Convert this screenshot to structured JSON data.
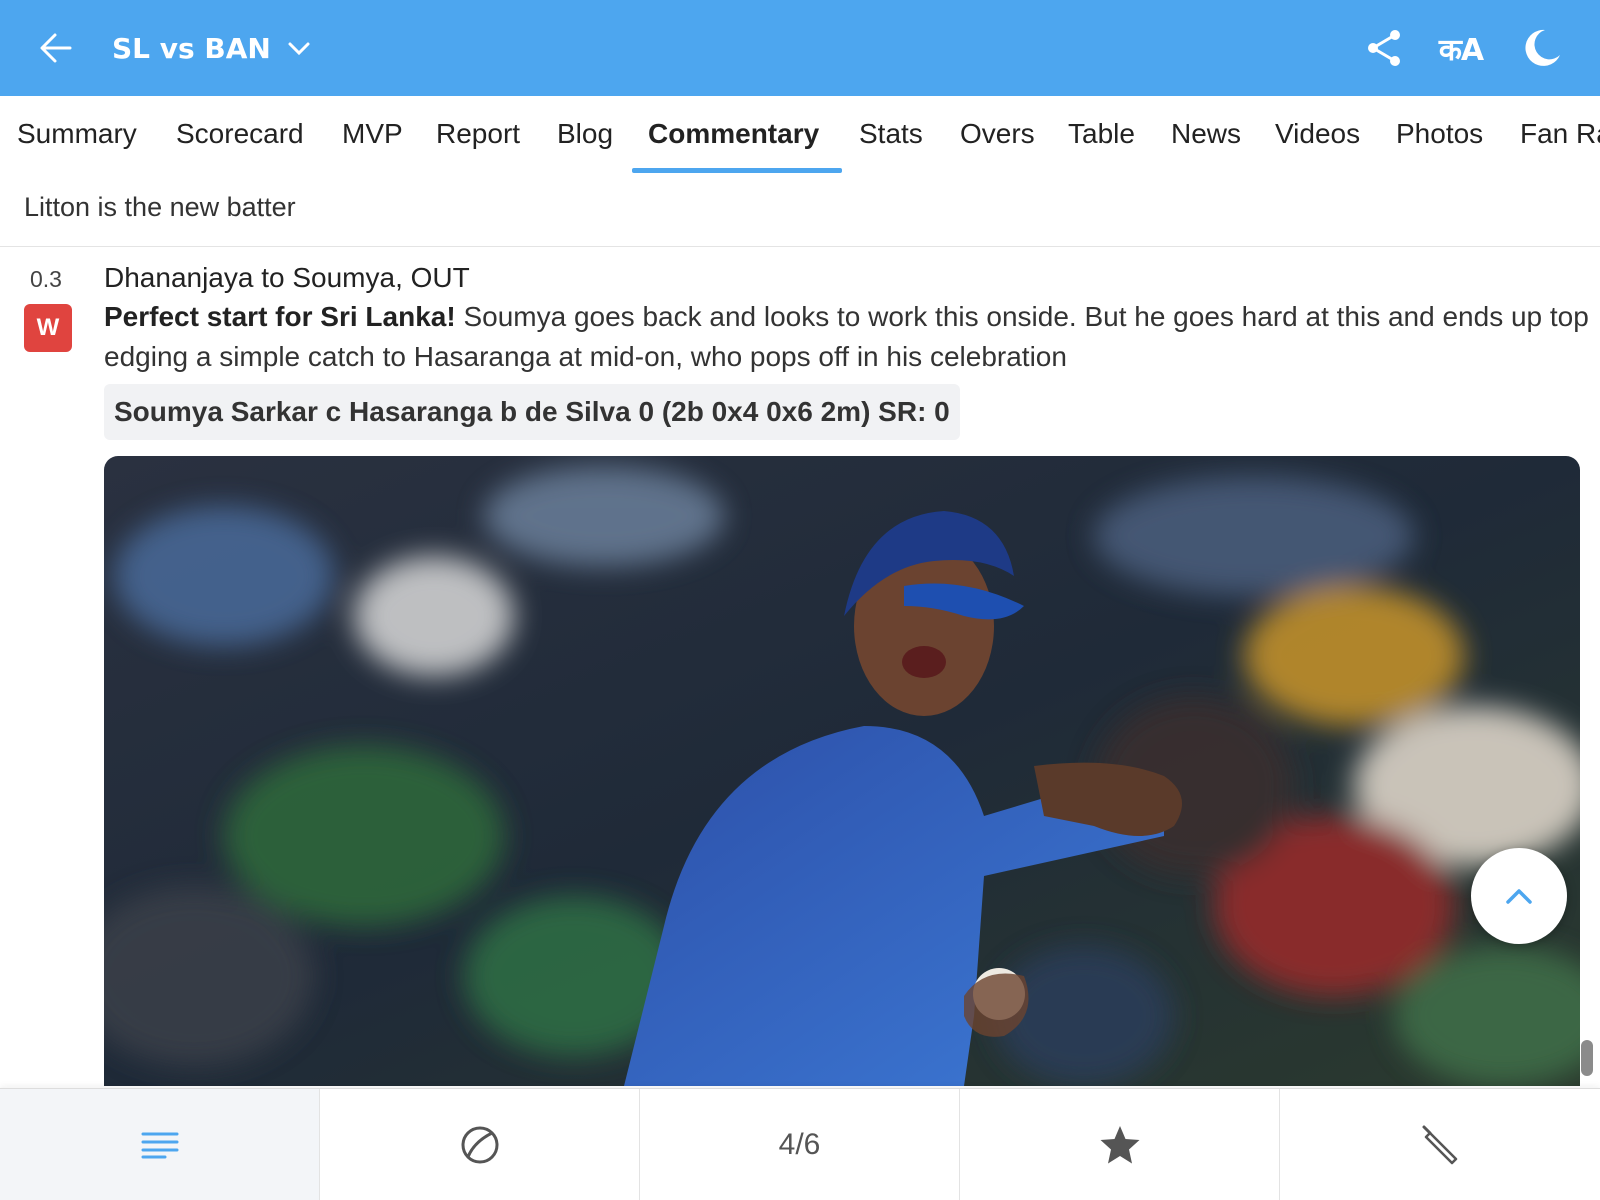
{
  "header": {
    "title": "SL vs BAN",
    "lang_label": "कA",
    "icons": [
      "back-arrow-icon",
      "chevron-down-icon",
      "share-icon",
      "language-icon",
      "moon-icon"
    ],
    "bg_color": "#4da6ef"
  },
  "tabs": [
    {
      "label": "Summary"
    },
    {
      "label": "Scorecard"
    },
    {
      "label": "MVP"
    },
    {
      "label": "Report"
    },
    {
      "label": "Blog"
    },
    {
      "label": "Commentary",
      "active": true
    },
    {
      "label": "Stats"
    },
    {
      "label": "Overs"
    },
    {
      "label": "Table"
    },
    {
      "label": "News"
    },
    {
      "label": "Videos"
    },
    {
      "label": "Photos"
    },
    {
      "label": "Fan Ra"
    }
  ],
  "commentary": {
    "previous_line": "Litton is the new batter",
    "ball": {
      "over": "0.3",
      "badge": "W",
      "badge_color": "#e0443f",
      "headline": "Dhananjaya to Soumya, OUT",
      "bold_lead": "Perfect start for Sri Lanka!",
      "text": " Soumya goes back and looks to work this onside. But he goes hard at this and ends up top edging a simple catch to Hasaranga at mid-on, who pops off in his celebration",
      "dismissal": "Soumya Sarkar c Hasaranga b de Silva 0 (2b 0x4 0x6 2m) SR: 0"
    }
  },
  "bottom_bar": {
    "items": [
      {
        "icon": "menu-lines-icon",
        "active": true
      },
      {
        "icon": "ball-icon"
      },
      {
        "label": "4/6"
      },
      {
        "icon": "star-icon"
      },
      {
        "icon": "bat-icon"
      }
    ]
  },
  "fab": {
    "icon": "chevron-up-icon"
  }
}
